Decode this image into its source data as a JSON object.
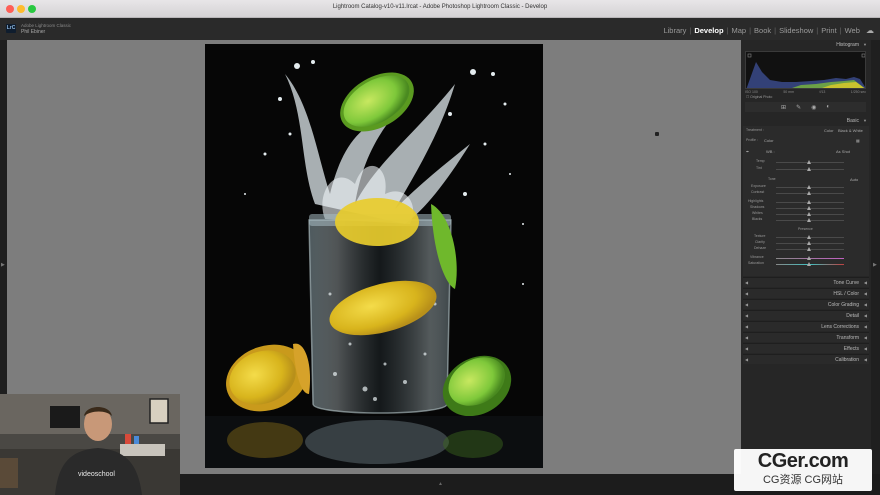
{
  "window": {
    "title": "Lightroom Catalog-v10-v11.lrcat - Adobe Photoshop Lightroom Classic - Develop"
  },
  "identity": {
    "badge": "LrC",
    "line1": "Adobe Lightroom Classic",
    "line2": "Phil Ebiner"
  },
  "modules": [
    {
      "label": "Library",
      "active": false
    },
    {
      "label": "Develop",
      "active": true
    },
    {
      "label": "Map",
      "active": false
    },
    {
      "label": "Book",
      "active": false
    },
    {
      "label": "Slideshow",
      "active": false
    },
    {
      "label": "Print",
      "active": false
    },
    {
      "label": "Web",
      "active": false
    }
  ],
  "right_panel": {
    "histogram_label": "Histogram",
    "histogram_footer": [
      "ISO 100",
      "50 mm",
      "f/13",
      "1/250 sec"
    ],
    "original_photo": "Original Photo",
    "basic_label": "Basic",
    "treatment_label": "Treatment :",
    "treatment_color": "Color",
    "treatment_bw": "Black & White",
    "profile_label": "Profile :",
    "profile_value": "Color",
    "wb_label": "WB :",
    "wb_value": "As Shot",
    "temp_label": "Temp",
    "tint_label": "Tint",
    "tone_label": "Tone",
    "tone_auto": "Auto",
    "exposure_label": "Exposure",
    "contrast_label": "Contrast",
    "highlights_label": "Highlights",
    "shadows_label": "Shadows",
    "whites_label": "Whites",
    "blacks_label": "Blacks",
    "presence_label": "Presence",
    "texture_label": "Texture",
    "clarity_label": "Clarity",
    "dehaze_label": "Dehaze",
    "vibrance_label": "Vibrance",
    "saturation_label": "Saturation",
    "sections": [
      "Tone Curve",
      "HSL / Color",
      "Color Grading",
      "Detail",
      "Lens Corrections",
      "Transform",
      "Effects",
      "Calibration"
    ]
  },
  "webcam": {
    "shirt_text": "videoschool"
  },
  "watermark": {
    "main": "CGer.com",
    "sub": "CG资源 CG网站"
  },
  "colors": {
    "accent_active": "#ffffff",
    "canvas_bg": "#7d7d7d",
    "panel_bg": "#262626",
    "lime": "#7ec83a",
    "lemon": "#e8c825"
  }
}
